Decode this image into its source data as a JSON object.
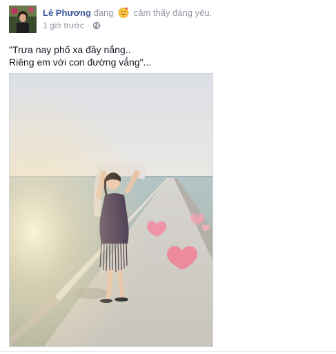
{
  "post": {
    "author": "Lê Phương",
    "activity_prefix": "đang",
    "activity_emoji": "smiling-face-with-hearts",
    "activity_text": "cảm thấy đáng yêu.",
    "timestamp": "1 giờ trước",
    "privacy_icon": "globe-icon",
    "status_lines": [
      "\"Trưa nay phố xa đầy nắng..",
      "Riêng em với con đường vắng\"..."
    ],
    "photo": {
      "subject": "woman-on-pier",
      "stickers": [
        "heart",
        "heart",
        "heart",
        "heart"
      ]
    }
  },
  "colors": {
    "author": "#3b5998",
    "muted": "#9197a3",
    "text": "#141823",
    "border": "#d3d6db",
    "heart": "#f07f93"
  }
}
